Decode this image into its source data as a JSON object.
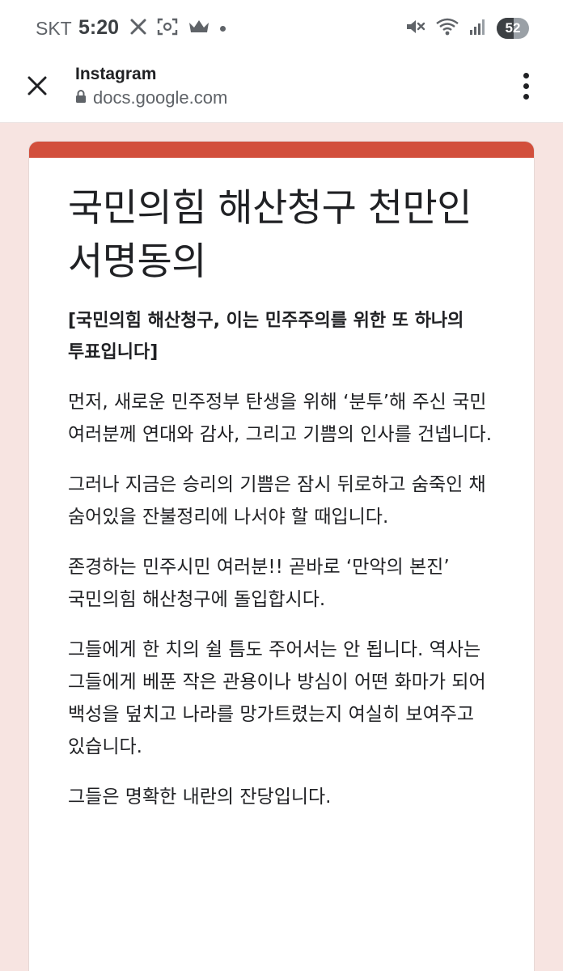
{
  "status_bar": {
    "carrier": "SKT",
    "time": "5:20",
    "battery": "52",
    "battery_level": 0.52
  },
  "tab": {
    "title": "Instagram",
    "url": "docs.google.com"
  },
  "colors": {
    "accent": "#d24f3c",
    "background": "#f7e4e1"
  },
  "form": {
    "title": "국민의힘 해산청구 천만인 서명동의",
    "subtitle": "[국민의힘 해산청구, 이는 민주주의를 위한 또 하나의 투표입니다]",
    "paragraphs": [
      "먼저, 새로운 민주정부 탄생을 위해 ‘분투’해 주신 국민 여러분께 연대와 감사, 그리고 기쁨의 인사를 건넵니다.",
      "그러나 지금은 승리의 기쁨은 잠시 뒤로하고 숨죽인 채 숨어있을 잔불정리에 나서야 할 때입니다.",
      "존경하는 민주시민 여러분!! 곧바로 ‘만악의 본진’ 국민의힘 해산청구에 돌입합시다.",
      "그들에게 한 치의 쉴 틈도 주어서는 안 됩니다. 역사는 그들에게 베푼 작은 관용이나 방심이 어떤 화마가 되어 백성을 덮치고 나라를 망가트렸는지 여실히 보여주고 있습니다.",
      "그들은 명확한 내란의 잔당입니다."
    ]
  }
}
